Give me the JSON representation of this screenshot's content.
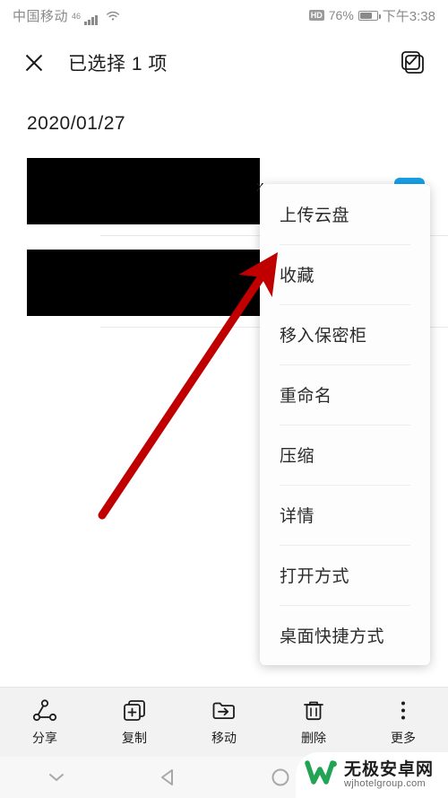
{
  "status_bar": {
    "carrier": "中国移动",
    "network_gen": "46",
    "signal_icon": "signal-bars-icon",
    "wifi_icon": "wifi-icon",
    "hd_badge": "HD",
    "battery_percent": "76%",
    "battery_level": 76,
    "battery_icon": "battery-icon",
    "time": "下午3:38"
  },
  "action_bar": {
    "close_icon": "close-icon",
    "title": "已选择 1 项",
    "select_all_icon": "select-all-checkbox-icon"
  },
  "list": {
    "date_header": "2020/01/27",
    "rows": [
      {
        "name_redacted": "",
        "ext_fragment": "x",
        "selected": false
      },
      {
        "name_redacted": "",
        "ext_fragment": "",
        "selected": true
      }
    ]
  },
  "popup_menu": {
    "items": [
      {
        "label": "上传云盘"
      },
      {
        "label": "收藏"
      },
      {
        "label": "移入保密柜"
      },
      {
        "label": "重命名"
      },
      {
        "label": "压缩"
      },
      {
        "label": "详情"
      },
      {
        "label": "打开方式"
      },
      {
        "label": "桌面快捷方式"
      }
    ]
  },
  "annotation": {
    "arrow_color": "#C00000",
    "points_at": "收藏"
  },
  "toolbar": {
    "items": [
      {
        "label": "分享",
        "icon": "share-icon"
      },
      {
        "label": "复制",
        "icon": "copy-icon"
      },
      {
        "label": "移动",
        "icon": "move-folder-icon"
      },
      {
        "label": "删除",
        "icon": "trash-icon"
      },
      {
        "label": "更多",
        "icon": "more-vertical-icon"
      }
    ]
  },
  "nav_bar": {
    "buttons": [
      {
        "icon": "chevron-down-icon"
      },
      {
        "icon": "back-triangle-icon"
      },
      {
        "icon": "home-circle-icon"
      }
    ]
  },
  "watermark": {
    "logo_icon": "w-logo-icon",
    "site_name": "无极安卓网",
    "site_url": "wjhotelgroup.com",
    "brand_color": "#23a455"
  },
  "colors": {
    "accent_blue": "#18a0e8",
    "toolbar_bg": "#f2f2f2",
    "text_primary": "#1d1d1d"
  }
}
